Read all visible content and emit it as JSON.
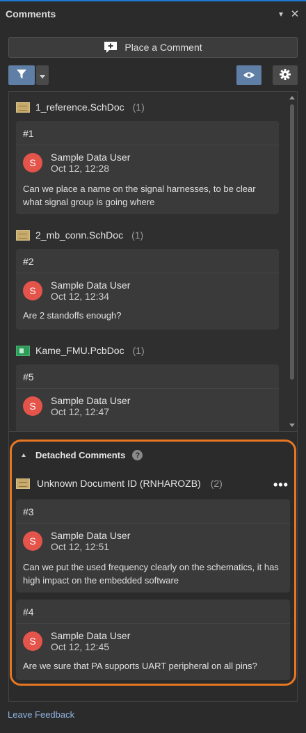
{
  "window": {
    "title": "Comments",
    "menu_glyph": "▾",
    "close_glyph": "✕"
  },
  "actions": {
    "place_comment": "Place a Comment"
  },
  "documents": [
    {
      "name": "1_reference.SchDoc",
      "count": "(1)",
      "icon": "schematic-doc-icon",
      "comment": {
        "number": "#1",
        "avatar": "S",
        "user": "Sample Data User",
        "time": "Oct 12, 12:28",
        "text": "Can we place a name on the signal harnesses, to be clear what signal group is going where"
      }
    },
    {
      "name": "2_mb_conn.SchDoc",
      "count": "(1)",
      "icon": "schematic-doc-icon",
      "comment": {
        "number": "#2",
        "avatar": "S",
        "user": "Sample Data User",
        "time": "Oct 12, 12:34",
        "text": "Are 2 standoffs enough?"
      }
    },
    {
      "name": "Kame_FMU.PcbDoc",
      "count": "(1)",
      "icon": "pcb-doc-icon",
      "comment": {
        "number": "#5",
        "avatar": "S",
        "user": "Sample Data User",
        "time": "Oct 12, 12:47",
        "text": ""
      }
    }
  ],
  "detached": {
    "header": "Detached Comments",
    "help": "?",
    "document": {
      "name": "Unknown Document ID (RNHAROZB)",
      "count": "(2)",
      "more": "•••"
    },
    "comments": [
      {
        "number": "#3",
        "avatar": "S",
        "user": "Sample Data User",
        "time": "Oct 12, 12:51",
        "text": "Can we put the used frequency clearly on the schematics, it has high impact on the embedded software"
      },
      {
        "number": "#4",
        "avatar": "S",
        "user": "Sample Data User",
        "time": "Oct 12, 12:45",
        "text": "Are we sure that PA supports UART peripheral on all pins?"
      }
    ]
  },
  "footer": {
    "feedback": "Leave Feedback"
  },
  "colors": {
    "accent_blue": "#5f7fa6",
    "avatar_red": "#e5544a",
    "highlight_orange": "#e87722",
    "link": "#8fb3e0"
  }
}
